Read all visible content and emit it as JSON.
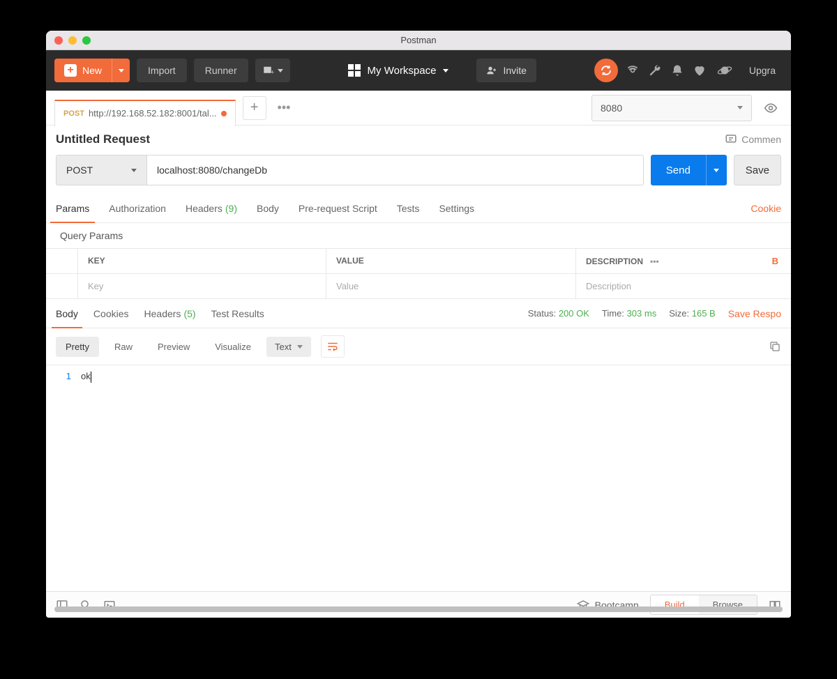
{
  "window": {
    "title": "Postman"
  },
  "toolbar": {
    "new_label": "New",
    "import_label": "Import",
    "runner_label": "Runner",
    "workspace_label": "My Workspace",
    "invite_label": "Invite",
    "upgrade_label": "Upgra"
  },
  "tabs": {
    "active": {
      "method": "POST",
      "url": "http://192.168.52.182:8001/tal..."
    }
  },
  "environment": {
    "selected": "8080"
  },
  "request": {
    "title": "Untitled Request",
    "comments_label": "Commen",
    "method": "POST",
    "url": "localhost:8080/changeDb",
    "send_label": "Send",
    "save_label": "Save",
    "tabs": {
      "params": "Params",
      "authorization": "Authorization",
      "headers": "Headers",
      "headers_count": "(9)",
      "body": "Body",
      "prerequest": "Pre-request Script",
      "tests": "Tests",
      "settings": "Settings",
      "cookies": "Cookie"
    },
    "query_params": {
      "section_label": "Query Params",
      "head_key": "KEY",
      "head_value": "VALUE",
      "head_desc": "DESCRIPTION",
      "bulk_label": "B",
      "placeholder_key": "Key",
      "placeholder_value": "Value",
      "placeholder_desc": "Description"
    }
  },
  "response": {
    "tabs": {
      "body": "Body",
      "cookies": "Cookies",
      "headers": "Headers",
      "headers_count": "(5)",
      "test_results": "Test Results"
    },
    "status_label": "Status:",
    "status_value": "200 OK",
    "time_label": "Time:",
    "time_value": "303 ms",
    "size_label": "Size:",
    "size_value": "165 B",
    "save_response": "Save Respo",
    "view": {
      "pretty": "Pretty",
      "raw": "Raw",
      "preview": "Preview",
      "visualize": "Visualize",
      "format": "Text"
    },
    "body_lines": [
      {
        "num": "1",
        "text": "ok"
      }
    ]
  },
  "statusbar": {
    "bootcamp": "Bootcamp",
    "build": "Build",
    "browse": "Browse"
  }
}
